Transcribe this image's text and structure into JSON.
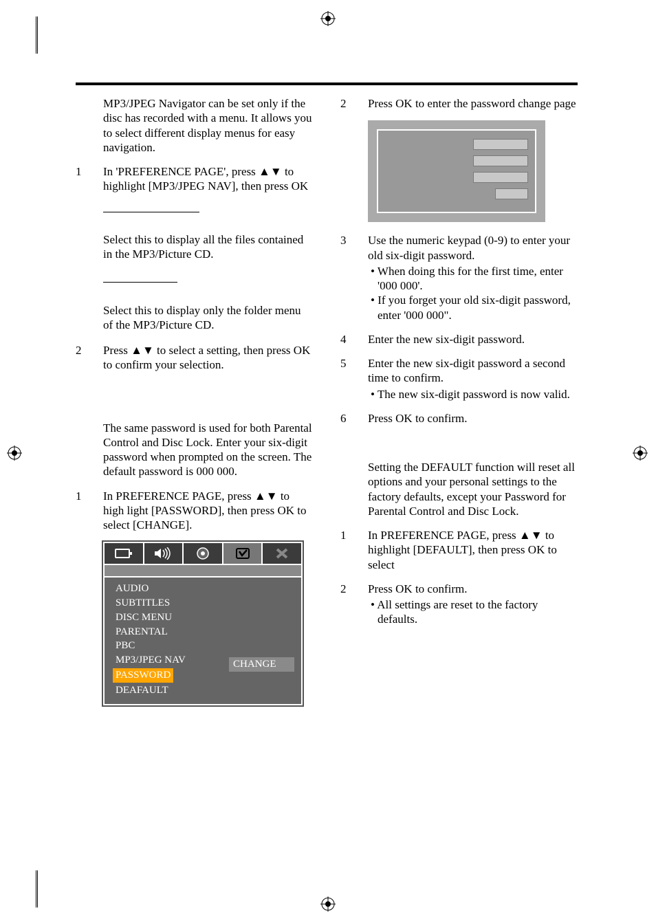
{
  "left": {
    "intro": "MP3/JPEG Navigator can be set only if the disc has recorded with a menu. It allows you to select different display menus for easy navigation.",
    "step1_num": "1",
    "step1_text": "In 'PREFERENCE PAGE', press ▲▼ to highlight [MP3/JPEG NAV], then press OK",
    "sub1_text": "Select this to display all the files contained in the MP3/Picture CD.",
    "sub2_text_line1": "Select this to display only the folder menu",
    "sub2_text_line2": "of the MP3/Picture CD.",
    "step2_num": "2",
    "step2_text": "Press ▲▼ to select a setting, then press OK to confirm your selection.",
    "pw_intro": "The same password is used for both Parental Control and Disc Lock. Enter your six-digit password when prompted on the screen. The default password is 000 000.",
    "pw_step1_num": "1",
    "pw_step1_text": "In PREFERENCE PAGE, press ▲▼ to high light [PASSWORD], then press OK to select [CHANGE]."
  },
  "right": {
    "step2_num": "2",
    "step2_text": "Press OK to enter the password change page",
    "step3_num": "3",
    "step3_text": "Use the numeric keypad (0-9) to enter your old six-digit password.",
    "step3_b1": "When doing this for the first time, enter '000 000'.",
    "step3_b2": "If you forget your old six-digit password, enter '000 000\".",
    "step4_num": "4",
    "step4_text": "Enter the new six-digit password.",
    "step5_num": "5",
    "step5_text": "Enter the new six-digit password a second time to confirm.",
    "step5_b1": "The new six-digit password is now valid.",
    "step6_num": "6",
    "step6_text": "Press OK to confirm.",
    "def_intro": "Setting the DEFAULT function will reset all options and your personal settings to the factory defaults, except your Password for Parental Control and Disc Lock.",
    "def_step1_num": "1",
    "def_step1_text": "In PREFERENCE PAGE, press ▲▼ to highlight [DEFAULT], then press OK to select",
    "def_step2_num": "2",
    "def_step2_text": "Press OK to confirm.",
    "def_step2_b1": "All settings are reset to the factory defaults."
  },
  "osd": {
    "items": {
      "i0": "AUDIO",
      "i1": "SUBTITLES",
      "i2": "DISC MENU",
      "i3": "PARENTAL",
      "i4": "PBC",
      "i5": "MP3/JPEG NAV",
      "i6": "PASSWORD",
      "i7": "DEAFAULT"
    },
    "right_value": "CHANGE"
  }
}
